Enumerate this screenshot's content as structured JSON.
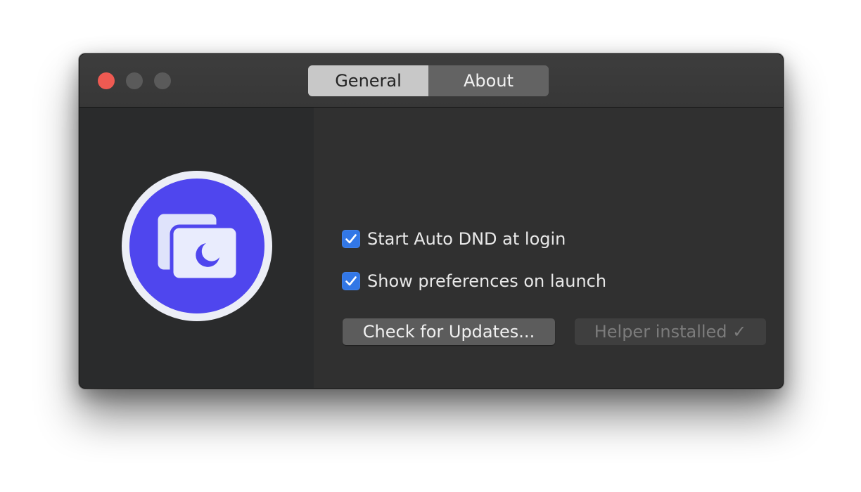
{
  "window": {
    "tabs": [
      {
        "label": "General",
        "selected": true
      },
      {
        "label": "About",
        "selected": false
      }
    ]
  },
  "preferences": {
    "start_at_login": {
      "label": "Start Auto DND at login",
      "checked": true
    },
    "show_prefs_on_launch": {
      "label": "Show preferences on launch",
      "checked": true
    }
  },
  "buttons": {
    "check_updates": "Check for Updates...",
    "helper_installed": "Helper installed ✓"
  },
  "colors": {
    "app_icon_blue": "#4f46ee",
    "checkbox_blue": "#3277e6",
    "close_red": "#ee5a52"
  },
  "icons": {
    "app": "auto-dnd-app-icon",
    "check": "checkmark-icon"
  }
}
